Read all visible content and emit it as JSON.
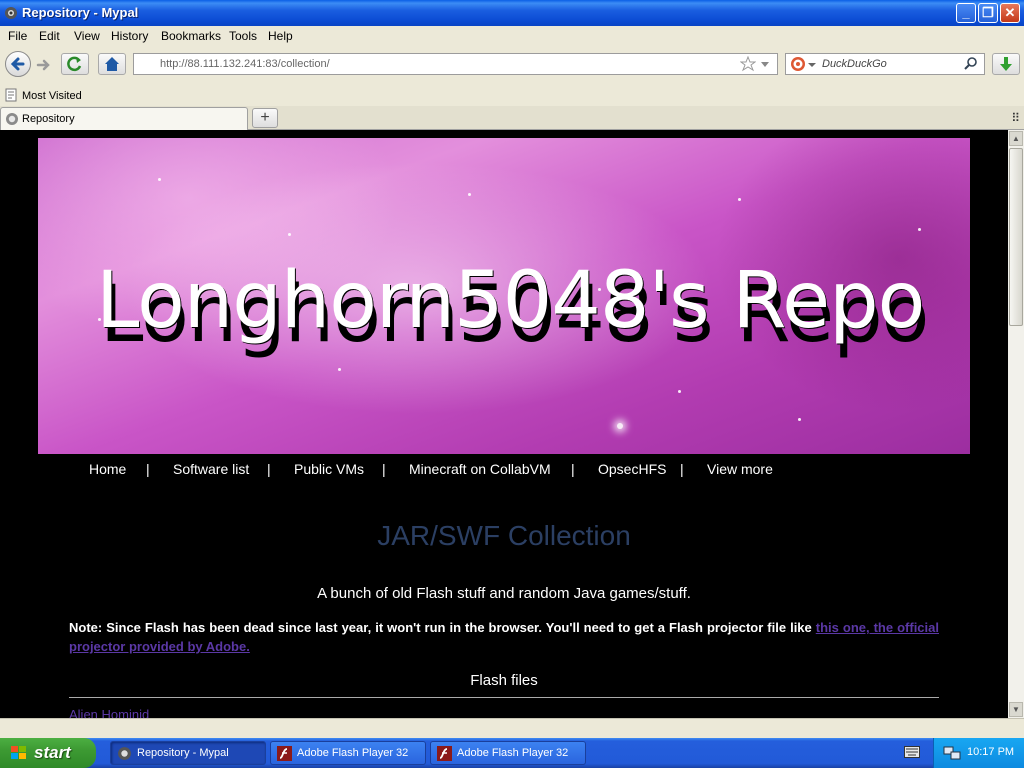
{
  "window": {
    "title": "Repository - Mypal",
    "minimize": "_",
    "maximize": "❐",
    "close": "✕"
  },
  "menu": [
    "File",
    "Edit",
    "View",
    "History",
    "Bookmarks",
    "Tools",
    "Help"
  ],
  "navbar": {
    "url_host": "http://88.111.132.241",
    "url_rest": ":83/collection/",
    "search_placeholder": "DuckDuckGo"
  },
  "bookmarks": {
    "most_visited": "Most Visited"
  },
  "tabs": [
    {
      "label": "Repository"
    }
  ],
  "page": {
    "banner_heading": "Longhorn5048's Repo",
    "nav": [
      "Home",
      "|",
      "Software list",
      "|",
      "Public VMs",
      "|",
      "Minecraft on CollabVM",
      "|",
      "OpsecHFS",
      "|",
      "View more"
    ],
    "title": "JAR/SWF Collection",
    "subtitle": "A bunch of old Flash stuff and random Java games/stuff.",
    "note_text": "Note: Since Flash has been dead since last year, it won't run in the browser. You'll need to get a Flash projector file like ",
    "note_link": "this one, the official projector provided by Adobe.",
    "section_heading": "Flash files",
    "first_item": "Alien Hominid"
  },
  "taskbar": {
    "start": "start",
    "tasks": [
      {
        "label": "Repository - Mypal",
        "active": true
      },
      {
        "label": "Adobe Flash Player 32",
        "active": false
      },
      {
        "label": "Adobe Flash Player 32",
        "active": false
      }
    ],
    "clock": "10:17 PM"
  },
  "colors": {
    "titlebar_blue": "#0b4bd3",
    "page_title": "#2b3f63",
    "link": "#5b38a6",
    "banner_pink": "#c955c7",
    "start_green": "#3d9a33"
  },
  "icons": [
    "mypal-icon",
    "back-arrow-icon",
    "forward-arrow-icon",
    "reload-icon",
    "home-icon",
    "star-icon",
    "dropdown-icon",
    "duckduckgo-icon",
    "magnifier-icon",
    "download-arrow-icon",
    "most-visited-icon",
    "globe-icon",
    "plus-icon",
    "tab-list-icon",
    "windows-flag-icon",
    "flash-icon",
    "keyboard-icon",
    "network-icon"
  ]
}
